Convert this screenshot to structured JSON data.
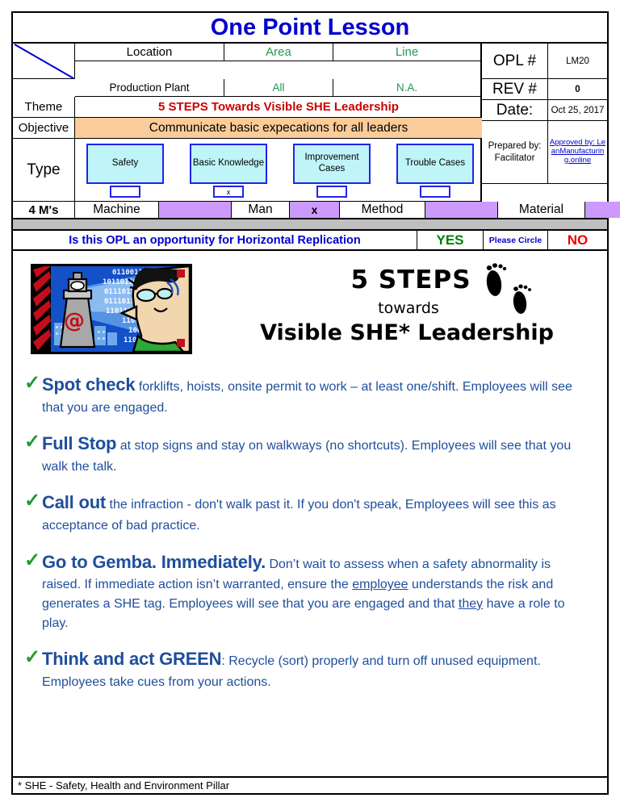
{
  "document": {
    "title": "One Point Lesson",
    "footer_note": "* SHE - Safety, Health and Environment Pillar"
  },
  "header": {
    "location_label": "Location",
    "location_value": "Production Plant",
    "area_label": "Area",
    "area_value": "All",
    "line_label": "Line",
    "line_value": "N.A.",
    "theme_label": "Theme",
    "theme_value": "5 STEPS Towards Visible SHE Leadership",
    "objective_label": "Objective",
    "objective_value": "Communicate basic expecations for all leaders",
    "opl_label": "OPL #",
    "opl_value": "LM20",
    "rev_label": "REV #",
    "rev_value": "0",
    "date_label": "Date:",
    "date_value": "Oct 25, 2017",
    "prepared_by": "Prepared by:\nFacilitator",
    "approved_by": "Approved by: LeanManufacturing.online"
  },
  "type_section": {
    "label": "Type",
    "options": [
      {
        "name": "Safety",
        "checked": ""
      },
      {
        "name": "Basic Knowledge",
        "checked": "x"
      },
      {
        "name": "Improvement Cases",
        "checked": ""
      },
      {
        "name": "Trouble Cases",
        "checked": ""
      }
    ]
  },
  "four_m": {
    "label": "4 M's",
    "items": [
      {
        "name": "Machine",
        "mark": ""
      },
      {
        "name": "Man",
        "mark": "x"
      },
      {
        "name": "Method",
        "mark": ""
      },
      {
        "name": "Material",
        "mark": ""
      }
    ]
  },
  "horizontal_replication": {
    "question": "Is this OPL an opportunity for Horizontal Replication",
    "yes": "YES",
    "instruction": "Please Circle",
    "no": "NO"
  },
  "body": {
    "headline_1": "5 STEPS",
    "headline_2": "towards",
    "headline_3": "Visible SHE* Leadership",
    "steps": [
      {
        "lead": "Spot check",
        "rest": " forklifts, hoists, onsite permit to work – at least one/shift. Employees will see that you are engaged."
      },
      {
        "lead": "Full Stop",
        "rest": " at stop signs and stay on walkways (no shortcuts).  Employees will see that you walk the talk."
      },
      {
        "lead": "Call out",
        "rest": "  the infraction  - don't walk past it.  If you don't speak, Employees will see this as acceptance of bad practice."
      },
      {
        "lead": "Go to Gemba. Immediately.",
        "rest": " Don’t wait to assess when a safety abnormality is raised. If immediate action isn’t warranted, ensure the @employee@ understands the risk and generates a SHE tag.  Employees will see that you are engaged and that @they@ have a role to play."
      },
      {
        "lead": "Think and act GREEN",
        "rest": ":  Recycle (sort) properly and turn off  unused equipment.  Employees take cues from your actions."
      }
    ]
  },
  "colors": {
    "title_blue": "#0000CC",
    "theme_red": "#CC0000",
    "objective_bg": "#FBCC99",
    "four_m_purple": "#CC99FF",
    "green_text": "#1F9A4C",
    "body_blue": "#1F4E9C",
    "check_green": "#1F9A2E",
    "yes_green": "#008000",
    "no_red": "#EE0000",
    "box_fill": "#BFF5F8",
    "box_border": "#2222EE"
  }
}
